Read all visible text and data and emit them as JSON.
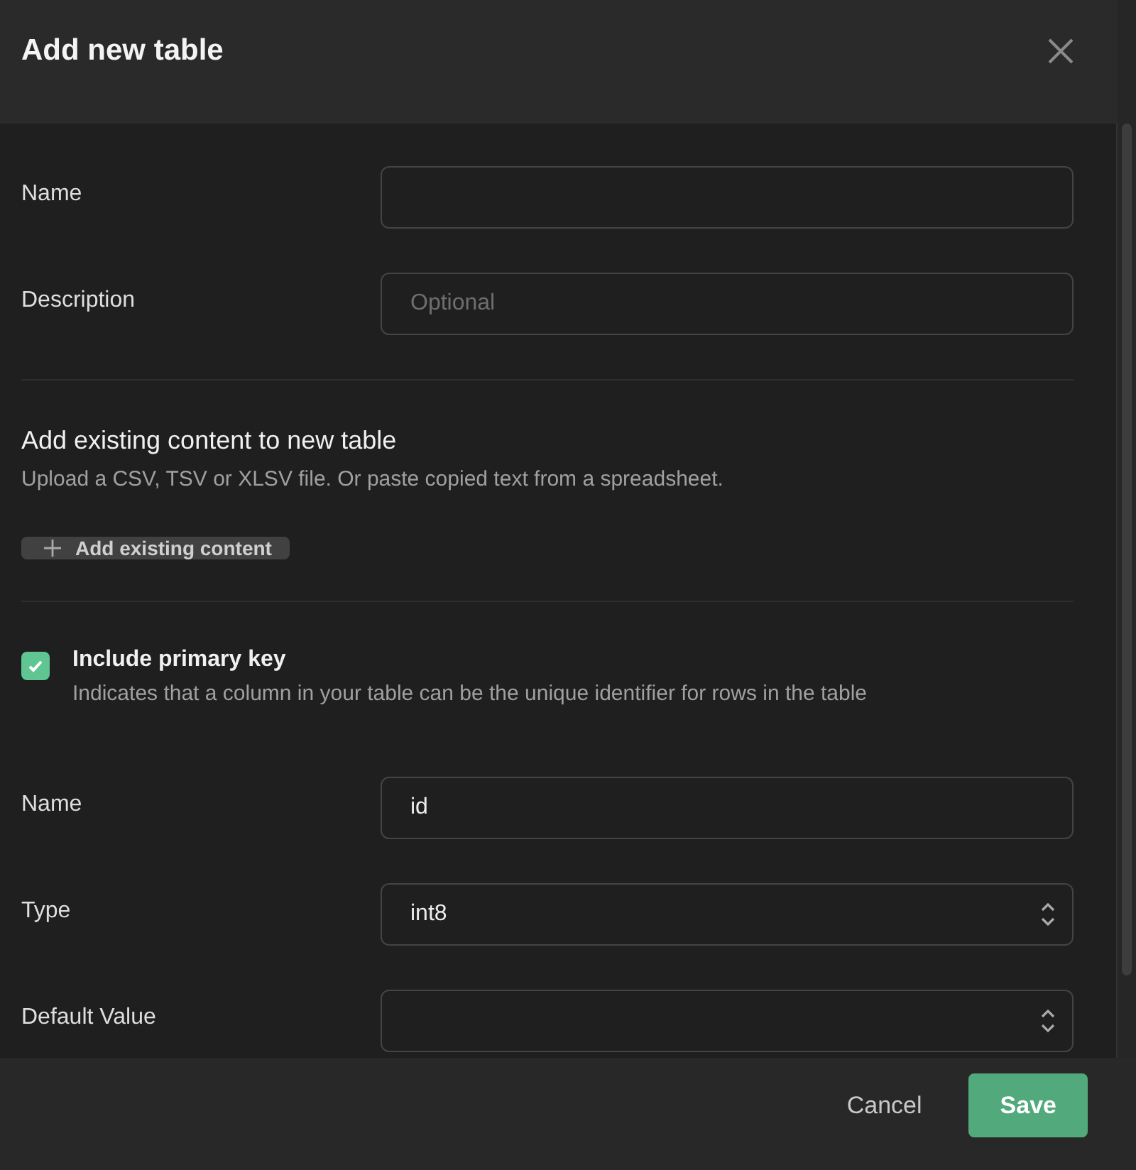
{
  "dialog": {
    "title": "Add new table"
  },
  "fields": [
    {
      "label": "Name"
    },
    {
      "label": "Description",
      "placeholder": "Optional"
    }
  ],
  "import_section": {
    "title": "Add existing content to new table",
    "description": "Upload a CSV, TSV or XLSV file. Or paste copied text from a spreadsheet.",
    "button": "Add existing content"
  },
  "primary_key": {
    "label": "Include primary key",
    "description": "Indicates that a column in your table can be the unique identifier for rows in the table",
    "checked": true
  },
  "column_fields": [
    {
      "kind": "input",
      "label": "Name",
      "value": "id"
    },
    {
      "kind": "select",
      "label": "Type",
      "value": "int8"
    },
    {
      "kind": "select",
      "label": "Default Value"
    }
  ],
  "footer": {
    "buttons": [
      {
        "label": "Cancel",
        "kind": "secondary"
      },
      {
        "label": "Save",
        "kind": "primary"
      }
    ]
  }
}
